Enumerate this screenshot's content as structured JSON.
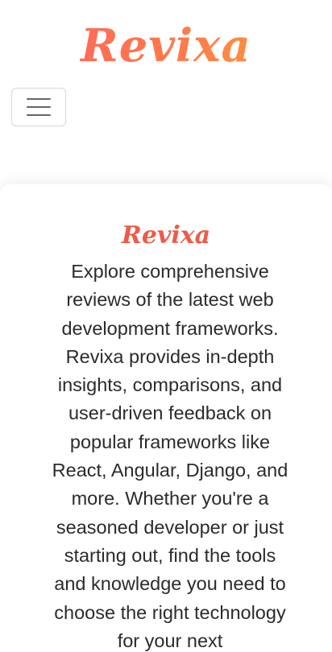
{
  "header": {
    "brand": "Revixa",
    "menu_toggle_icon": "hamburger-menu-icon"
  },
  "hero": {
    "title": "Revixa",
    "description": "Explore comprehensive reviews of the latest web development frameworks. Revixa provides in-depth insights, comparisons, and user-driven feedback on popular frameworks like React, Angular, Django, and more. Whether you're a seasoned developer or just starting out, find the tools and knowledge you need to choose the right technology for your next"
  },
  "colors": {
    "brand_gradient_start": "#ff5f5f",
    "brand_gradient_end": "#ffa23a",
    "title_color": "#ef5b45",
    "text_color": "#2b2b2b"
  }
}
